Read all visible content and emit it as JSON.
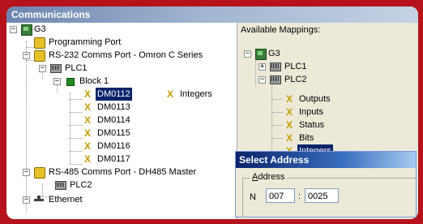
{
  "window": {
    "title": "Communications"
  },
  "left_tree": {
    "root": "G3",
    "programming_port": "Programming Port",
    "rs232": "RS-232 Comms Port - Omron C Series",
    "plc1": "PLC1",
    "block1": "Block 1",
    "registers": [
      "DM0112",
      "DM0113",
      "DM0114",
      "DM0115",
      "DM0116",
      "DM0117"
    ],
    "mapping_label": "Integers",
    "rs485": "RS-485 Comms Port - DH485 Master",
    "plc2": "PLC2",
    "ethernet": "Ethernet"
  },
  "right_pane": {
    "title": "Available Mappings:",
    "root": "G3",
    "plc1": "PLC1",
    "plc2": "PLC2",
    "items": [
      "Outputs",
      "Inputs",
      "Status",
      "Bits",
      "Integers"
    ]
  },
  "dialog": {
    "title": "Select Address",
    "group_label_first": "A",
    "group_label_rest": "ddress",
    "prefix": "N",
    "file_value": "007",
    "colon": ":",
    "element_value": "0025"
  }
}
